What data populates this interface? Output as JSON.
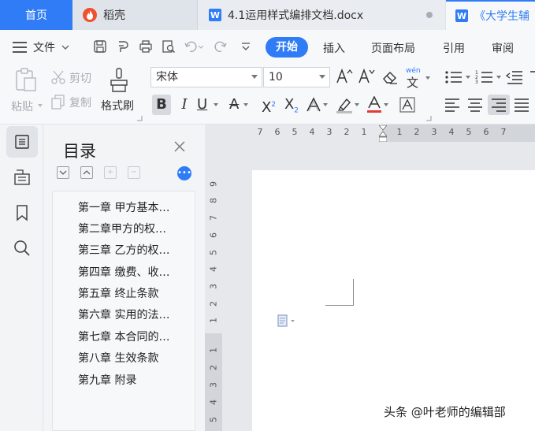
{
  "tabs": {
    "home": "首页",
    "daoke": "稻壳",
    "doc": "4.1运用样式编排文档.docx",
    "doc2": "《大学生辅"
  },
  "menu": {
    "file": "文件",
    "start": "开始",
    "insert": "插入",
    "layout": "页面布局",
    "reference": "引用",
    "review": "审阅"
  },
  "ribbon": {
    "cut": "剪切",
    "paste": "粘贴",
    "copy": "复制",
    "format_painter": "格式刷",
    "font_name": "宋体",
    "font_size": "10",
    "phonetic_label": "wén"
  },
  "toc": {
    "title": "目录",
    "items": [
      "第一章 甲方基本…",
      "第二章甲方的权…",
      "第三章 乙方的权…",
      "第四章 缴费、收…",
      "第五章 终止条款",
      "第六章 实用的法…",
      "第七章 本合同的…",
      "第八章 生效条款",
      "第九章 附录"
    ]
  },
  "ruler": {
    "h_left": [
      "7",
      "6",
      "5",
      "4",
      "3",
      "2",
      "1"
    ],
    "h_right": [
      "1",
      "2",
      "3",
      "4",
      "5",
      "6",
      "7"
    ],
    "v_top": [
      "9",
      "8",
      "7",
      "6",
      "5",
      "4",
      "3",
      "2",
      "1"
    ],
    "v_bottom": [
      "1",
      "2",
      "3",
      "4",
      "5"
    ]
  },
  "watermark": "头条 @叶老师的编辑部",
  "colors": {
    "accent": "#2f7cf6",
    "daoke": "#ef5030",
    "font_color_bar": "#e53935"
  }
}
